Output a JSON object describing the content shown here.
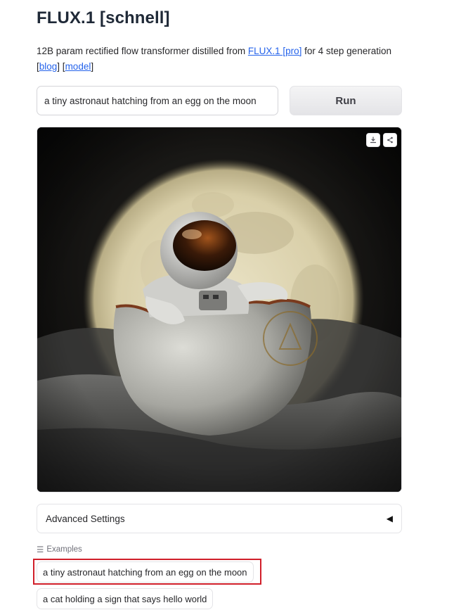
{
  "header": {
    "title": "FLUX.1 [schnell]",
    "desc_prefix": "12B param rectified flow transformer distilled from ",
    "link_pro": "FLUX.1 [pro]",
    "desc_suffix": " for 4 step generation",
    "bracket_open": "[",
    "link_blog": "blog",
    "bracket_mid": "] [",
    "link_model": "model",
    "bracket_close": "]"
  },
  "prompt": {
    "value": "a tiny astronaut hatching from an egg on the moon"
  },
  "run_button": {
    "label": "Run"
  },
  "image_panel": {
    "download_icon": "download-icon",
    "share_icon": "share-icon"
  },
  "advanced": {
    "label": "Advanced Settings",
    "icon": "triangle-left-icon"
  },
  "examples": {
    "label": "Examples",
    "icon": "list-icon",
    "items": [
      "a tiny astronaut hatching from an egg on the moon",
      "a cat holding a sign that says hello world"
    ]
  },
  "colors": {
    "link": "#2563eb",
    "highlight": "#d11f2a"
  }
}
